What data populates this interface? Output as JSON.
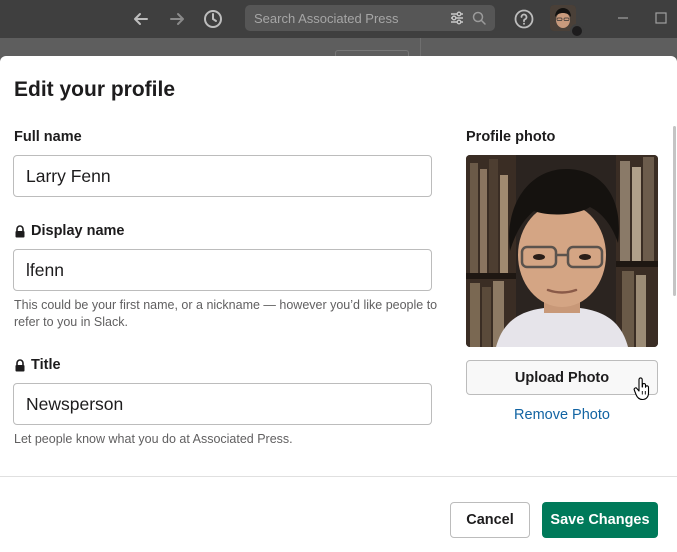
{
  "topbar": {
    "search_placeholder": "Search Associated Press",
    "icons": [
      "back-arrow-icon",
      "forward-arrow-icon",
      "history-icon",
      "filter-icon",
      "search-icon",
      "help-icon",
      "minimize-icon",
      "maximize-icon"
    ]
  },
  "modal": {
    "title": "Edit your profile",
    "full_name": {
      "label": "Full name",
      "value": "Larry Fenn"
    },
    "display_name": {
      "label": "Display name",
      "value": "lfenn",
      "hint": "This could be your first name, or a nickname — however you’d like people to refer to you in Slack."
    },
    "title_field": {
      "label": "Title",
      "value": "Newsperson",
      "hint": "Let people know what you do at Associated Press."
    },
    "photo": {
      "label": "Profile photo",
      "upload_label": "Upload Photo",
      "remove_label": "Remove Photo"
    },
    "footer": {
      "cancel_label": "Cancel",
      "save_label": "Save Changes"
    }
  },
  "colors": {
    "primary": "#007a5a",
    "link": "#1264a3",
    "text": "#1d1c1d",
    "overlay": "#5b5b5b"
  }
}
